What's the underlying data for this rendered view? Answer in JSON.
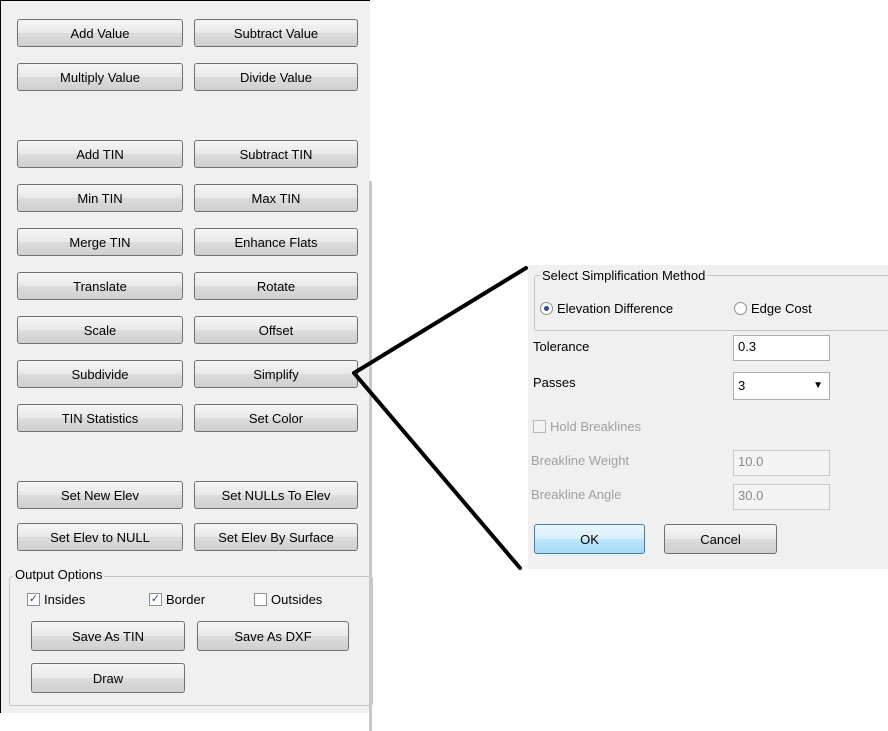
{
  "left": {
    "buttons": {
      "add_value": "Add Value",
      "subtract_value": "Subtract Value",
      "multiply_value": "Multiply Value",
      "divide_value": "Divide Value",
      "add_tin": "Add TIN",
      "subtract_tin": "Subtract TIN",
      "min_tin": "Min TIN",
      "max_tin": "Max TIN",
      "merge_tin": "Merge TIN",
      "enhance_flats": "Enhance Flats",
      "translate": "Translate",
      "rotate": "Rotate",
      "scale": "Scale",
      "offset": "Offset",
      "subdivide": "Subdivide",
      "simplify": "Simplify",
      "tin_statistics": "TIN Statistics",
      "set_color": "Set Color",
      "set_new_elev": "Set New Elev",
      "set_nulls_to_elev": "Set NULLs To Elev",
      "set_elev_to_null": "Set Elev to NULL",
      "set_elev_by_surface": "Set Elev By Surface"
    },
    "output_options": {
      "title": "Output Options",
      "insides": {
        "label": "Insides",
        "checked": true
      },
      "border": {
        "label": "Border",
        "checked": true
      },
      "outsides": {
        "label": "Outsides",
        "checked": false
      },
      "save_as_tin": "Save As TIN",
      "save_as_dxf": "Save As DXF",
      "draw": "Draw"
    }
  },
  "dialog": {
    "method_group_title": "Select Simplification Method",
    "radio_elevation": {
      "label": "Elevation Difference",
      "selected": true
    },
    "radio_edge_cost": {
      "label": "Edge Cost",
      "selected": false
    },
    "tolerance_label": "Tolerance",
    "tolerance_value": "0.3",
    "passes_label": "Passes",
    "passes_value": "3",
    "hold_breaklines": {
      "label": "Hold Breaklines",
      "checked": false,
      "enabled": false
    },
    "breakline_weight_label": "Breakline Weight",
    "breakline_weight_value": "10.0",
    "breakline_angle_label": "Breakline Angle",
    "breakline_angle_value": "30.0",
    "ok": "OK",
    "cancel": "Cancel"
  },
  "colors": {
    "panel_bg": "#f0f0f0",
    "check_mark": "#2a4ea3",
    "disabled_text": "#a0a0a0"
  }
}
